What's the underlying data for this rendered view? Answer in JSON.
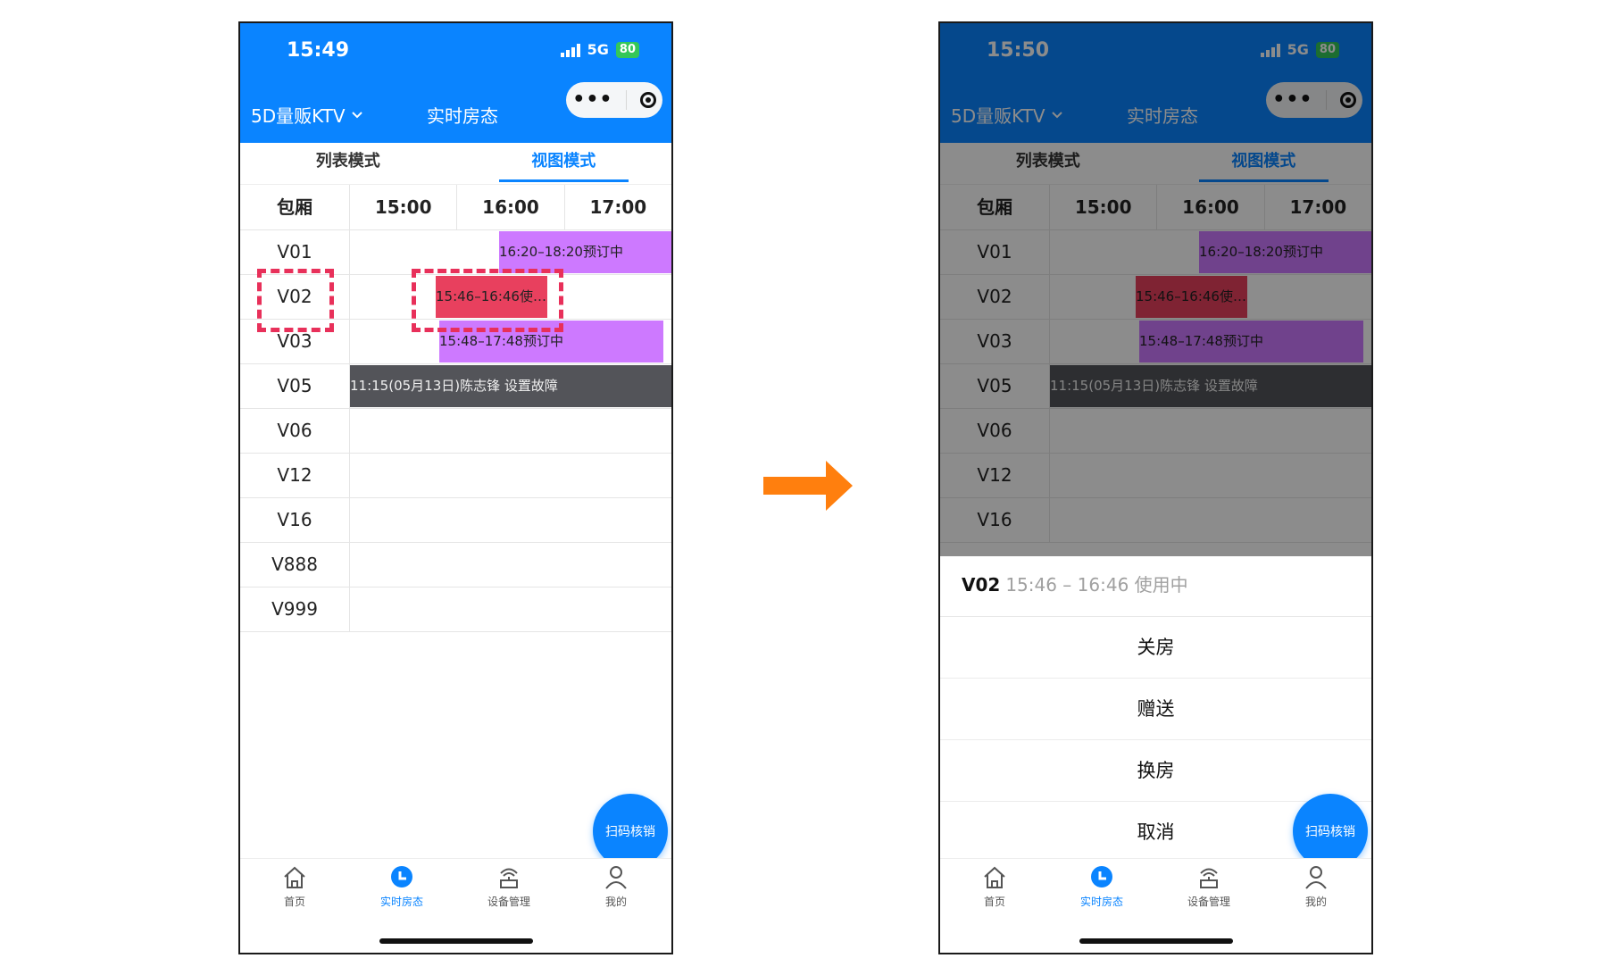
{
  "left": {
    "status": {
      "time": "15:49",
      "network": "5G",
      "battery": "80"
    },
    "nav": {
      "store": "5D量贩KTV",
      "title": "实时房态",
      "capsule_menu": "•••"
    },
    "tabs": [
      {
        "label": "列表模式"
      },
      {
        "label": "视图模式"
      }
    ],
    "grid": {
      "room_header": "包厢",
      "time_columns": [
        "15:00",
        "16:00",
        "17:00"
      ],
      "rooms": [
        "V01",
        "V02",
        "V03",
        "V05",
        "V06",
        "V12",
        "V16",
        "V888",
        "V999"
      ],
      "bookings": {
        "v01": "16:20–18:20预订中",
        "v02": "15:46–16:46使…",
        "v03": "15:48–17:48预订中",
        "v05": "11:15(05月13日)陈志锋 设置故障"
      }
    },
    "fab": "扫码核销",
    "tabbar": [
      "首页",
      "实时房态",
      "设备管理",
      "我的"
    ]
  },
  "right": {
    "status": {
      "time": "15:50",
      "network": "5G",
      "battery": "80"
    },
    "nav": {
      "store": "5D量贩KTV",
      "title": "实时房态",
      "capsule_menu": "•••"
    },
    "tabs": [
      {
        "label": "列表模式"
      },
      {
        "label": "视图模式"
      }
    ],
    "grid": {
      "room_header": "包厢",
      "time_columns": [
        "15:00",
        "16:00",
        "17:00"
      ],
      "rooms": [
        "V01",
        "V02",
        "V03",
        "V05",
        "V06",
        "V12",
        "V16"
      ],
      "bookings": {
        "v01": "16:20–18:20预订中",
        "v02": "15:46–16:46使…",
        "v03": "15:48–17:48预订中",
        "v05": "11:15(05月13日)陈志锋 设置故障"
      }
    },
    "sheet": {
      "room": "V02",
      "info": "15:46 – 16:46 使用中",
      "options": [
        "关房",
        "赠送",
        "换房",
        "取消"
      ]
    },
    "fab": "扫码核销",
    "tabbar": [
      "首页",
      "实时房态",
      "设备管理",
      "我的"
    ]
  },
  "colors": {
    "header_blue": "#0a84ff",
    "booking_purple": "#cd79ff",
    "in_use_red": "#e8405e",
    "fault_gray": "#535459",
    "highlight_dash": "#e8305a",
    "arrow_orange": "#ff7f0e"
  }
}
